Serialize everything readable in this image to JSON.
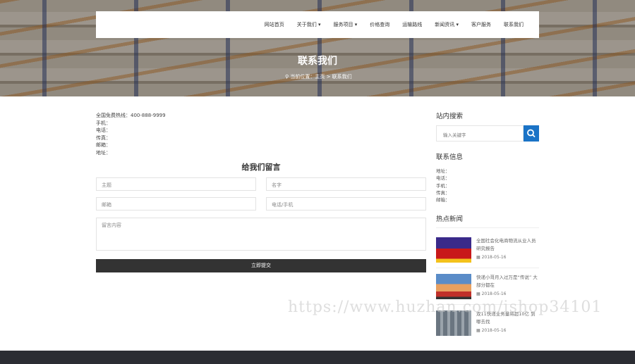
{
  "nav": {
    "items": [
      "网站首页",
      "关于我们 ▾",
      "服务项目 ▾",
      "价格查询",
      "运输路线",
      "新闻资讯 ▾",
      "客户服务",
      "联系我们"
    ]
  },
  "banner": {
    "title": "联系我们",
    "breadcrumb": "当前位置：主页 > 联系我们"
  },
  "contact": {
    "lines": [
      "全国免费热线：400-888-9999",
      "手机：",
      "电话：",
      "传真：",
      "邮箱：",
      "地址："
    ]
  },
  "form": {
    "title": "给我们留言",
    "subject": "主题",
    "name": "名字",
    "email": "邮箱",
    "phone": "电话/手机",
    "message": "留言内容",
    "submit": "立即提交"
  },
  "sidebar": {
    "search_title": "站内搜索",
    "search_placeholder": "输入关键字",
    "contact_title": "联系信息",
    "contact_lines": [
      "地址：",
      "电话：",
      "手机：",
      "传真：",
      "邮箱："
    ],
    "news_title": "热点新闻",
    "news": [
      {
        "title": "全国社会化电商物流从业人员研究报告",
        "date": "2018-05-16"
      },
      {
        "title": "快递小哥月入过万是“传说” 大部分都在",
        "date": "2018-05-16"
      },
      {
        "title": "双11快递业务量将超10亿 到哪去找",
        "date": "2018-05-16"
      }
    ]
  },
  "watermark": "https://www.huzhan.com/ishop34101"
}
